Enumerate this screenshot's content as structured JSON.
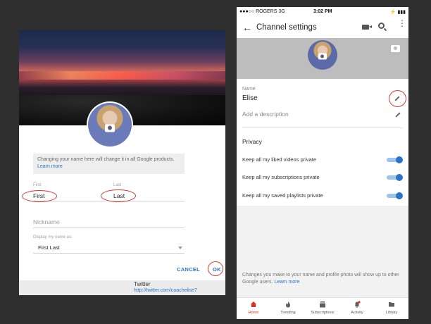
{
  "left_dialog": {
    "notice_text": "Changing your name here will change it in all Google products.",
    "notice_link": "Learn more",
    "first_label": "First",
    "first_value": "First",
    "last_label": "Last",
    "last_value": "Last",
    "nickname_placeholder": "Nickname",
    "display_label": "Display my name as:",
    "display_value": "First Last",
    "cancel_label": "CANCEL",
    "ok_label": "OK",
    "background_title": "Twitter",
    "background_link": "http://twitter.com/coachelise7"
  },
  "right_screen": {
    "status": {
      "carrier": "●●●○○ ROGERS  3G",
      "time": "3:02 PM",
      "icons": "⚡ ▮▮▮"
    },
    "appbar": {
      "back": "←",
      "title": "Channel settings"
    },
    "profile": {
      "name_label": "Name",
      "name_value": "Elise",
      "description_placeholder": "Add a description"
    },
    "privacy": {
      "heading": "Privacy",
      "rows": [
        {
          "label": "Keep all my liked videos private",
          "on": true
        },
        {
          "label": "Keep all my subscriptions private",
          "on": true
        },
        {
          "label": "Keep all my saved playlists private",
          "on": true
        }
      ]
    },
    "footer_note": "Changes you make to your name and profile photo will show up to other Google users.",
    "footer_link": "Learn more",
    "tabs": [
      {
        "label": "Home",
        "icon": "home-icon",
        "active": true
      },
      {
        "label": "Trending",
        "icon": "flame-icon",
        "active": false
      },
      {
        "label": "Subscriptions",
        "icon": "subscriptions-icon",
        "active": false
      },
      {
        "label": "Activity",
        "icon": "bell-icon",
        "active": false
      },
      {
        "label": "Library",
        "icon": "folder-icon",
        "active": false
      }
    ]
  },
  "colors": {
    "accent_blue": "#2a73c9",
    "annotation_red": "#d23c2f",
    "youtube_red": "#e52d27"
  }
}
